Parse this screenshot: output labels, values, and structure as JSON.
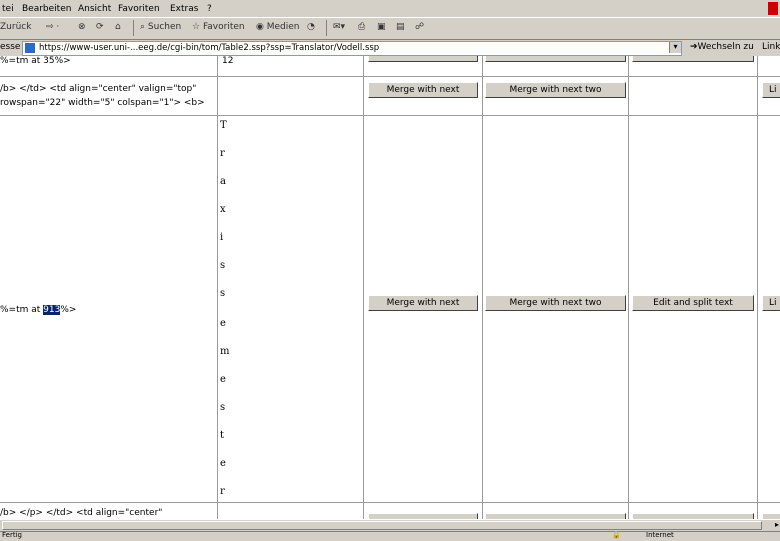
{
  "menu": [
    "tei",
    "Bearbeiten",
    "Ansicht",
    "Favoriten",
    "Extras",
    "?"
  ],
  "toolbar": {
    "back": "Zurück",
    "search": "Suchen",
    "favorites": "Favoriten",
    "media": "Medien"
  },
  "address": {
    "label": "esse",
    "url": "https://www-user.uni-...eeg.de/cgi-bin/tom/Table2.ssp?ssp=Translator/Vodell.ssp",
    "go": "Wechseln zu",
    "links": "Links"
  },
  "rows": {
    "r0": {
      "left": "%=tm at 35%>",
      "mid": "12"
    },
    "r1": {
      "line1": "/b> </td> <td align=\"center\" valign=\"top\"",
      "line2": "rowspan=\"22\" width=\"5\" colspan=\"1\"> <b>"
    },
    "r2": {
      "before": "%=tm at ",
      "highlight": "913",
      "after": "%>"
    },
    "r3": {
      "text": "/b> </p> </td> <td align=\"center\""
    }
  },
  "vertical_word": [
    "T",
    "r",
    "a",
    "x",
    "i",
    "s",
    "s",
    "e",
    "m",
    "e",
    "s",
    "t",
    "e",
    "r"
  ],
  "buttons": {
    "merge_next": "Merge with next",
    "merge_two": "Merge with next two",
    "edit_split": "Edit and split text",
    "edge": "Li"
  },
  "status": {
    "left": "Fertig",
    "right": "Internet"
  }
}
